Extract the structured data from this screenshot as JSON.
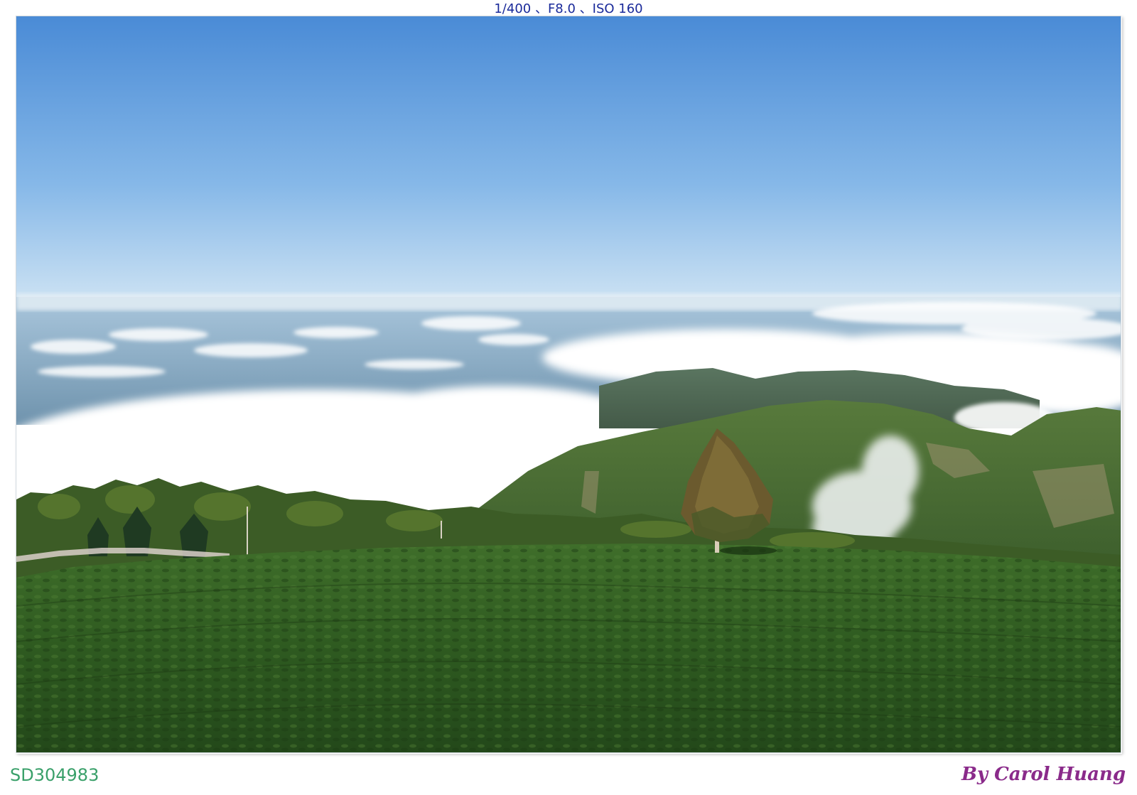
{
  "caption": {
    "exif": "1/400 、F8.0 、ISO 160",
    "code": "SD304983",
    "credit": "By Carol Huang"
  },
  "colors": {
    "exif_text": "#1a2a9a",
    "code_text": "#3aa06a",
    "credit_text": "#8a2a8a",
    "sky_top": "#4a8bd6",
    "sky_bottom": "#cfe4f4",
    "tea_field": "#2f5a22"
  }
}
